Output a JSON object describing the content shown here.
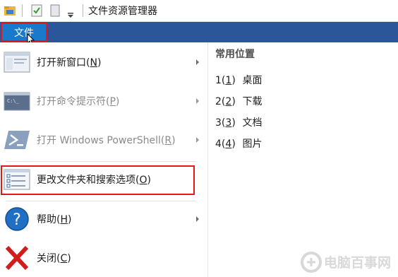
{
  "window": {
    "title": "文件资源管理器"
  },
  "ribbon": {
    "file_tab": "文件"
  },
  "file_menu": {
    "items": [
      {
        "label": "打开新窗口(N)",
        "mnemonic": "N",
        "has_submenu": true,
        "enabled": true,
        "icon": "new-window-icon"
      },
      {
        "label": "打开命令提示符(P)",
        "mnemonic": "P",
        "has_submenu": true,
        "enabled": false,
        "icon": "command-prompt-icon"
      },
      {
        "label": "打开 Windows PowerShell(R)",
        "mnemonic": "R",
        "has_submenu": true,
        "enabled": false,
        "icon": "powershell-icon"
      },
      {
        "label": "更改文件夹和搜索选项(O)",
        "mnemonic": "O",
        "has_submenu": false,
        "enabled": true,
        "icon": "folder-options-icon",
        "highlighted": true
      },
      {
        "label": "帮助(H)",
        "mnemonic": "H",
        "has_submenu": true,
        "enabled": true,
        "icon": "help-icon"
      },
      {
        "label": "关闭(C)",
        "mnemonic": "C",
        "has_submenu": false,
        "enabled": true,
        "icon": "close-icon"
      }
    ]
  },
  "frequent_places": {
    "title": "常用位置",
    "items": [
      {
        "key": "1",
        "name": "桌面"
      },
      {
        "key": "2",
        "name": "下载"
      },
      {
        "key": "3",
        "name": "文档"
      },
      {
        "key": "4",
        "name": "图片"
      }
    ]
  },
  "colors": {
    "ribbon": "#2b579a",
    "file_tab": "#1979ca",
    "annotation_red": "#e01a1a"
  },
  "watermark": {
    "text": "电脑百事网"
  }
}
